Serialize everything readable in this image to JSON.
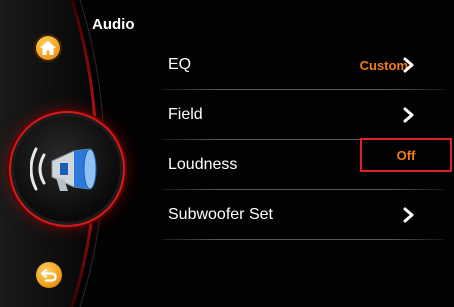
{
  "header": {
    "title": "Audio"
  },
  "nav": {
    "home_icon": "home-icon",
    "back_icon": "back-icon",
    "source_icon": "speaker-megaphone-icon"
  },
  "menu": {
    "items": [
      {
        "label": "EQ",
        "value": "Custom"
      },
      {
        "label": "Field",
        "value": ""
      },
      {
        "label": "Loudness",
        "value": "Off"
      },
      {
        "label": "Subwoofer Set",
        "value": ""
      }
    ]
  },
  "colors": {
    "accent_orange": "#f07c1a",
    "highlight_red": "#e3202a",
    "background": "#020202"
  }
}
